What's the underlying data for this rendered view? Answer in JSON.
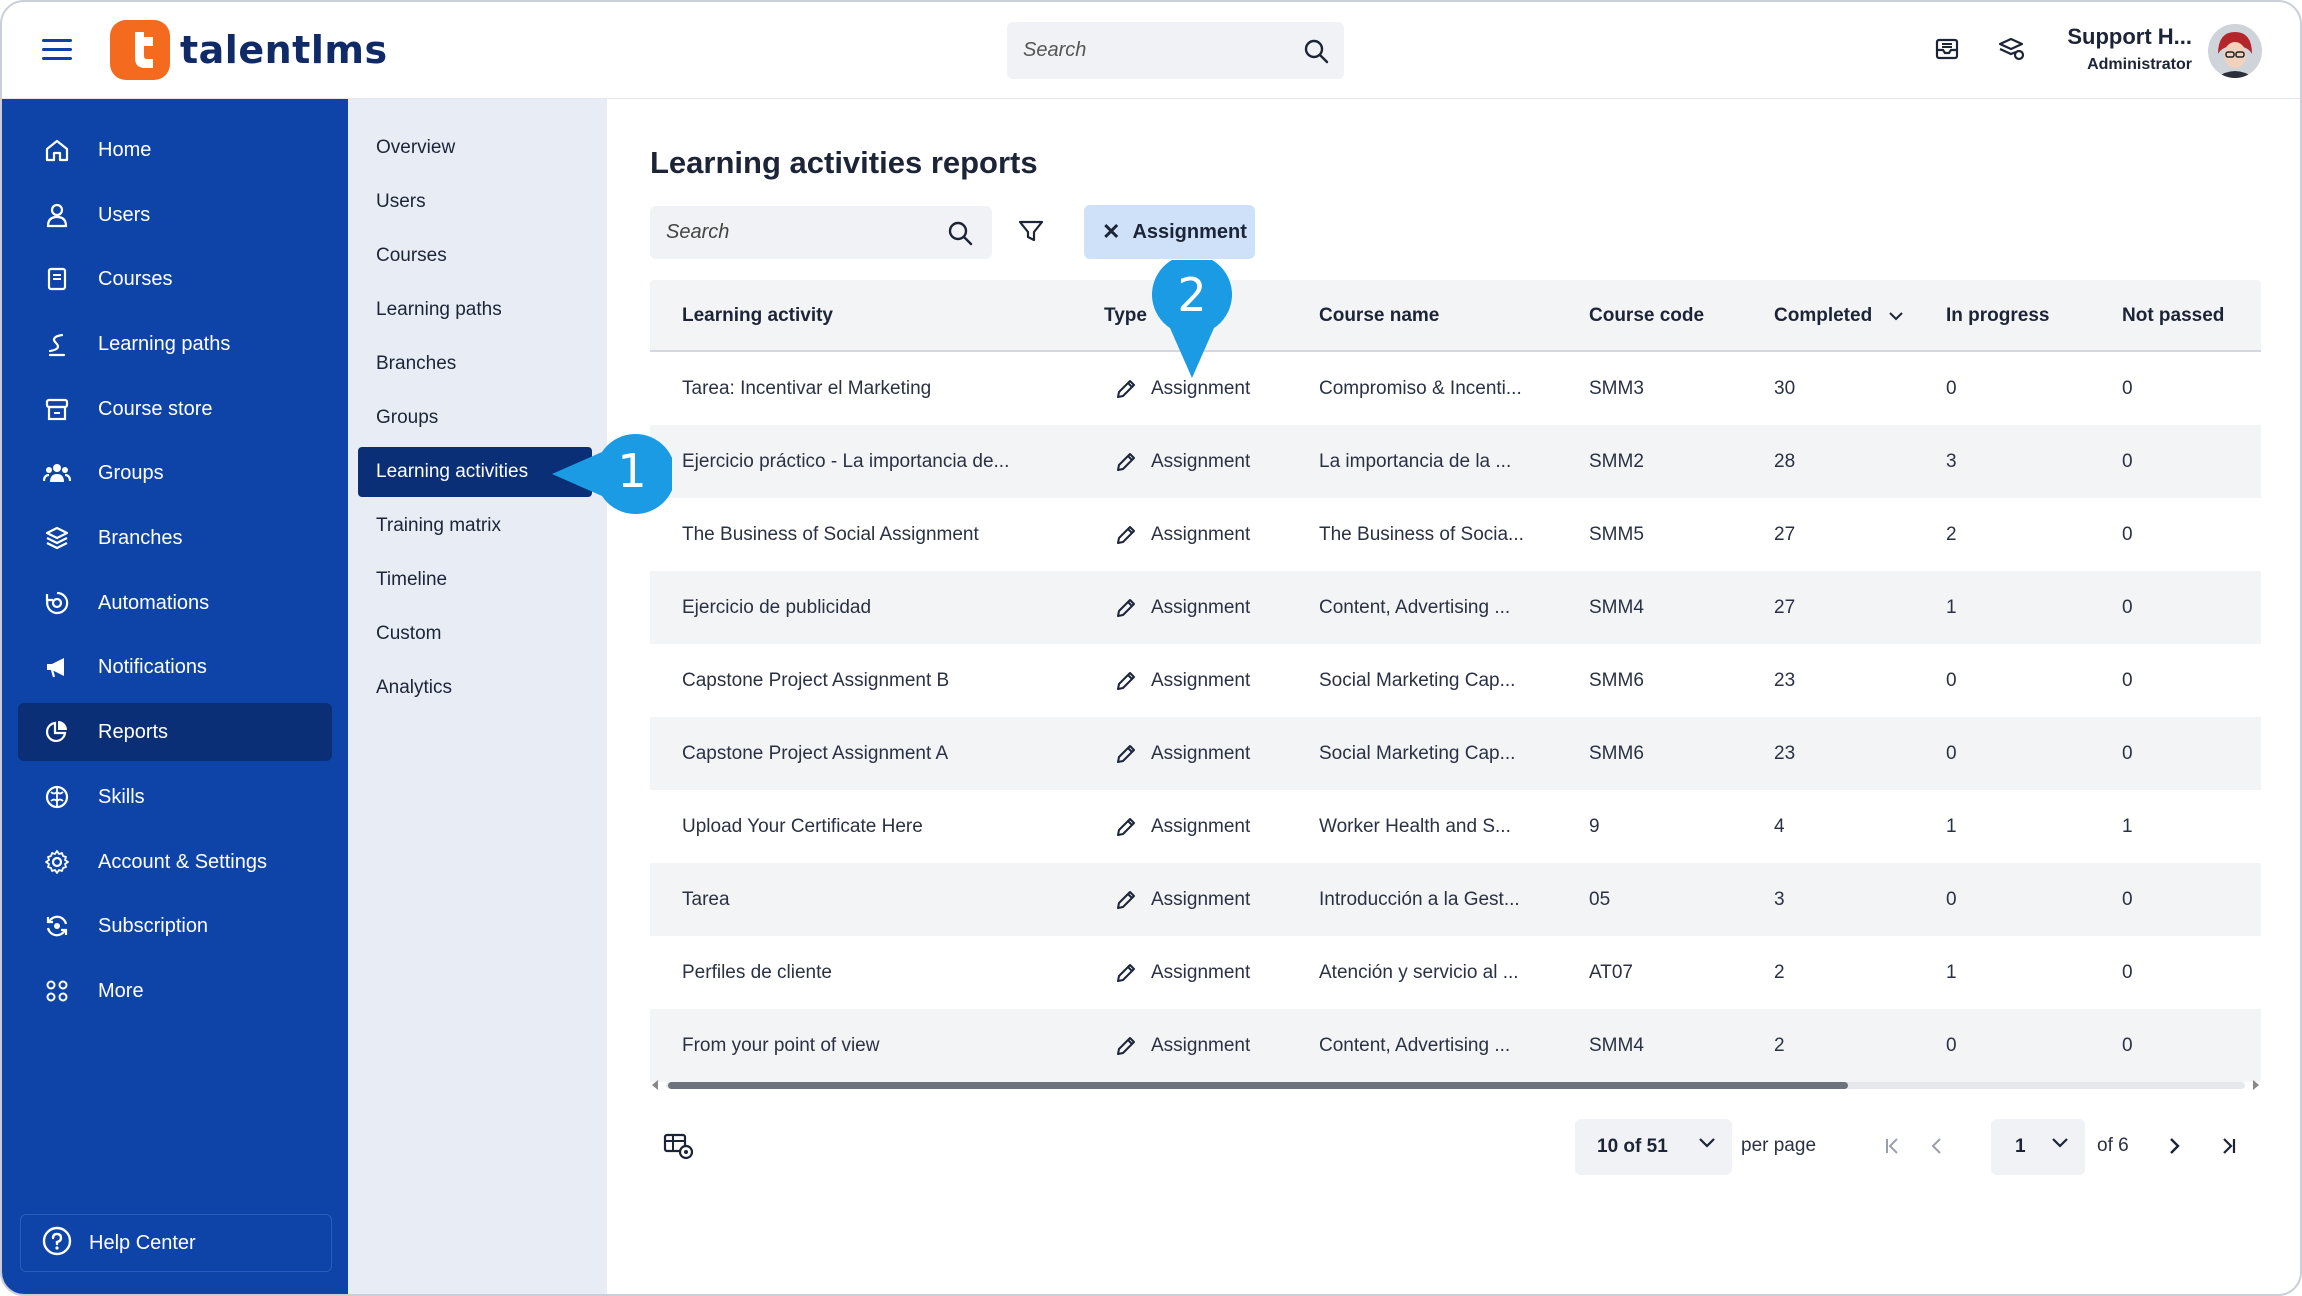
{
  "topbar": {
    "brand": "talentlms",
    "search_placeholder": "Search",
    "user_name": "Support H...",
    "user_role": "Administrator"
  },
  "sidebar": {
    "items": [
      {
        "label": "Home",
        "icon": "home-icon"
      },
      {
        "label": "Users",
        "icon": "user-icon"
      },
      {
        "label": "Courses",
        "icon": "book-icon"
      },
      {
        "label": "Learning paths",
        "icon": "path-icon"
      },
      {
        "label": "Course store",
        "icon": "store-icon"
      },
      {
        "label": "Groups",
        "icon": "groups-icon"
      },
      {
        "label": "Branches",
        "icon": "layers-icon"
      },
      {
        "label": "Automations",
        "icon": "automation-icon"
      },
      {
        "label": "Notifications",
        "icon": "megaphone-icon"
      },
      {
        "label": "Reports",
        "icon": "pie-chart-icon"
      },
      {
        "label": "Skills",
        "icon": "brain-icon"
      },
      {
        "label": "Account & Settings",
        "icon": "gear-icon"
      },
      {
        "label": "Subscription",
        "icon": "refresh-icon"
      },
      {
        "label": "More",
        "icon": "grid-icon"
      }
    ],
    "active": "Reports",
    "help": "Help Center"
  },
  "subnav": {
    "items": [
      "Overview",
      "Users",
      "Courses",
      "Learning paths",
      "Branches",
      "Groups",
      "Learning activities",
      "Training matrix",
      "Timeline",
      "Custom",
      "Analytics"
    ],
    "active": "Learning activities"
  },
  "main": {
    "title": "Learning activities reports",
    "search_placeholder": "Search",
    "filter_chip": "Assignment",
    "columns": [
      "Learning activity",
      "Type",
      "Course name",
      "Course code",
      "Completed",
      "In progress",
      "Not passed"
    ],
    "rows": [
      [
        "Tarea: Incentivar el Marketing",
        "Assignment",
        "Compromiso & Incenti...",
        "SMM3",
        "30",
        "0",
        "0"
      ],
      [
        "Ejercicio práctico - La importancia de...",
        "Assignment",
        "La importancia de la ...",
        "SMM2",
        "28",
        "3",
        "0"
      ],
      [
        "The Business of Social Assignment",
        "Assignment",
        "The Business of Socia...",
        "SMM5",
        "27",
        "2",
        "0"
      ],
      [
        "Ejercicio de publicidad",
        "Assignment",
        "Content, Advertising ...",
        "SMM4",
        "27",
        "1",
        "0"
      ],
      [
        "Capstone Project Assignment B",
        "Assignment",
        "Social Marketing Cap...",
        "SMM6",
        "23",
        "0",
        "0"
      ],
      [
        "Capstone Project Assignment A",
        "Assignment",
        "Social Marketing Cap...",
        "SMM6",
        "23",
        "0",
        "0"
      ],
      [
        "Upload Your Certificate Here",
        "Assignment",
        "Worker Health and S...",
        "9",
        "4",
        "1",
        "1"
      ],
      [
        "Tarea",
        "Assignment",
        "Introducción a la Gest...",
        "05",
        "3",
        "0",
        "0"
      ],
      [
        "Perfiles de cliente",
        "Assignment",
        "Atención y servicio al ...",
        "AT07",
        "2",
        "1",
        "0"
      ],
      [
        "From your point of view",
        "Assignment",
        "Content, Advertising ...",
        "SMM4",
        "2",
        "0",
        "0"
      ]
    ],
    "pagination": {
      "per_page_value": "10 of 51",
      "per_page_label": "per page",
      "page": "1",
      "of_pages": "of 6"
    }
  },
  "callouts": [
    "1",
    "2"
  ],
  "colors": {
    "sidebar": "#0e44a8",
    "active": "#0a2f76",
    "brand_orange": "#f46b1f",
    "callout": "#1a9be3"
  }
}
